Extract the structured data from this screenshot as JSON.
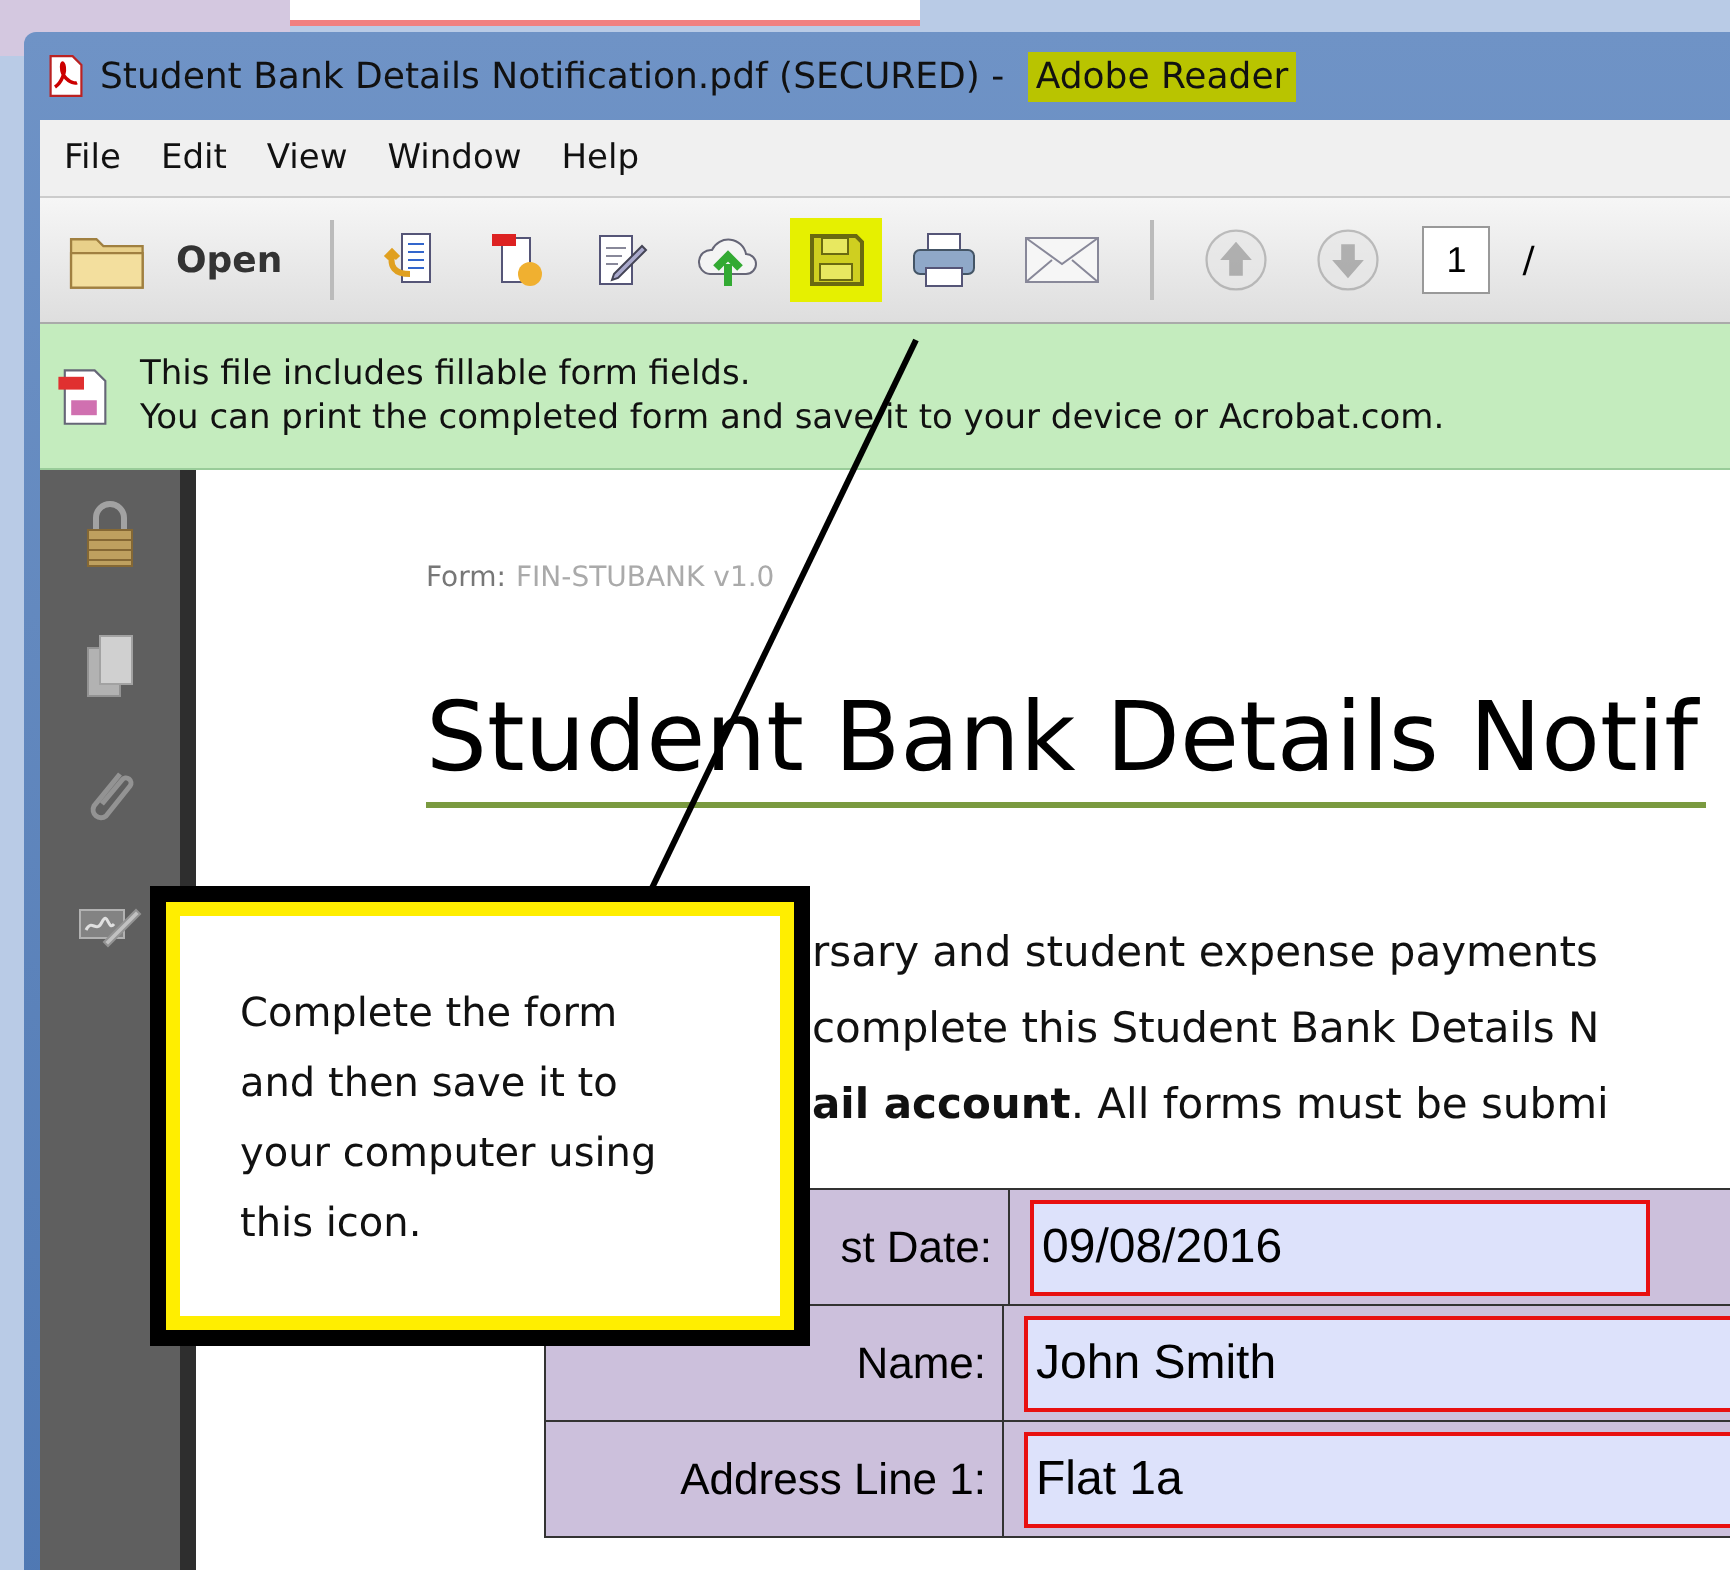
{
  "window": {
    "title": "Student Bank Details Notification.pdf (SECURED) - ",
    "app_name": {
      "text": "Adobe Reader",
      "highlighted": true
    }
  },
  "menu": [
    "File",
    "Edit",
    "View",
    "Window",
    "Help"
  ],
  "toolbar": {
    "open_label": "Open",
    "tools": [
      {
        "kind": "export",
        "highlighted": false
      },
      {
        "kind": "create",
        "highlighted": false
      },
      {
        "kind": "edit",
        "highlighted": false
      },
      {
        "kind": "cloud",
        "highlighted": false
      },
      {
        "kind": "save",
        "highlighted": true
      },
      {
        "kind": "print",
        "highlighted": false
      },
      {
        "kind": "email",
        "highlighted": false
      }
    ],
    "navigation": [
      {
        "kind": "up",
        "disabled": true
      },
      {
        "kind": "down",
        "disabled": true
      }
    ],
    "page_number": "1",
    "page_separator": "/"
  },
  "info_bar": {
    "lines": [
      "This file includes fillable form fields.",
      "You can print the completed form and save it to your device or Acrobat.com."
    ]
  },
  "sidebar": {
    "tools": [
      {
        "kind": "lock"
      },
      {
        "kind": "pages"
      },
      {
        "kind": "attachment"
      },
      {
        "kind": "signature"
      }
    ]
  },
  "document": {
    "form_label": "Form:",
    "form_code": "FIN-STUBANK v1.0",
    "title": "Student Bank Details Notif",
    "paragraph_lines": [
      "rsary and student expense payments",
      "complete this Student Bank Details N",
      "**ail account**.  All forms must be submi"
    ],
    "fields": [
      {
        "kind": "short",
        "label": "st Date:",
        "value": "09/08/2016"
      },
      {
        "kind": "wide",
        "label": "Name:",
        "value": "John Smith"
      },
      {
        "kind": "wide",
        "label": "Address Line 1:",
        "value": "Flat 1a"
      }
    ]
  },
  "callout": {
    "text": "Complete the form and then save it to your computer using this icon."
  }
}
